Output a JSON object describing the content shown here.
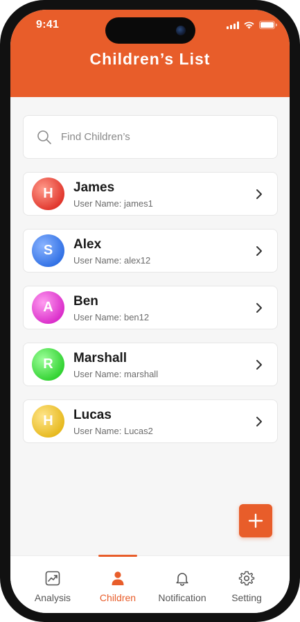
{
  "status_bar": {
    "time": "9:41"
  },
  "header": {
    "title": "Children’s List"
  },
  "search": {
    "placeholder": "Find Children’s",
    "value": ""
  },
  "children": [
    {
      "initial": "H",
      "name": "James",
      "username": "User Name: james1",
      "avatar_color_from": "#ff9a8a",
      "avatar_color_to": "#e0342a"
    },
    {
      "initial": "S",
      "name": "Alex",
      "username": "User Name: alex12",
      "avatar_color_from": "#8ab4ff",
      "avatar_color_to": "#2f6fe4"
    },
    {
      "initial": "A",
      "name": "Ben",
      "username": "User Name: ben12",
      "avatar_color_from": "#ff9cf0",
      "avatar_color_to": "#d92bc9"
    },
    {
      "initial": "R",
      "name": "Marshall",
      "username": "User Name: marshall",
      "avatar_color_from": "#9dff9a",
      "avatar_color_to": "#2fd12f"
    },
    {
      "initial": "H",
      "name": "Lucas",
      "username": "User Name: Lucas2",
      "avatar_color_from": "#ffe58a",
      "avatar_color_to": "#e6b81c"
    }
  ],
  "fab": {
    "icon": "plus-icon"
  },
  "bottom_nav": {
    "active": "children",
    "items": [
      {
        "key": "analysis",
        "label": "Analysis",
        "icon": "chart-icon"
      },
      {
        "key": "children",
        "label": "Children",
        "icon": "person-icon"
      },
      {
        "key": "notification",
        "label": "Notification",
        "icon": "bell-icon"
      },
      {
        "key": "setting",
        "label": "Setting",
        "icon": "gear-icon"
      }
    ]
  },
  "colors": {
    "accent": "#e85d2a",
    "background": "#f6f6f6",
    "card": "#ffffff",
    "text_primary": "#1a1a1a",
    "text_secondary": "#6b6b6b"
  }
}
